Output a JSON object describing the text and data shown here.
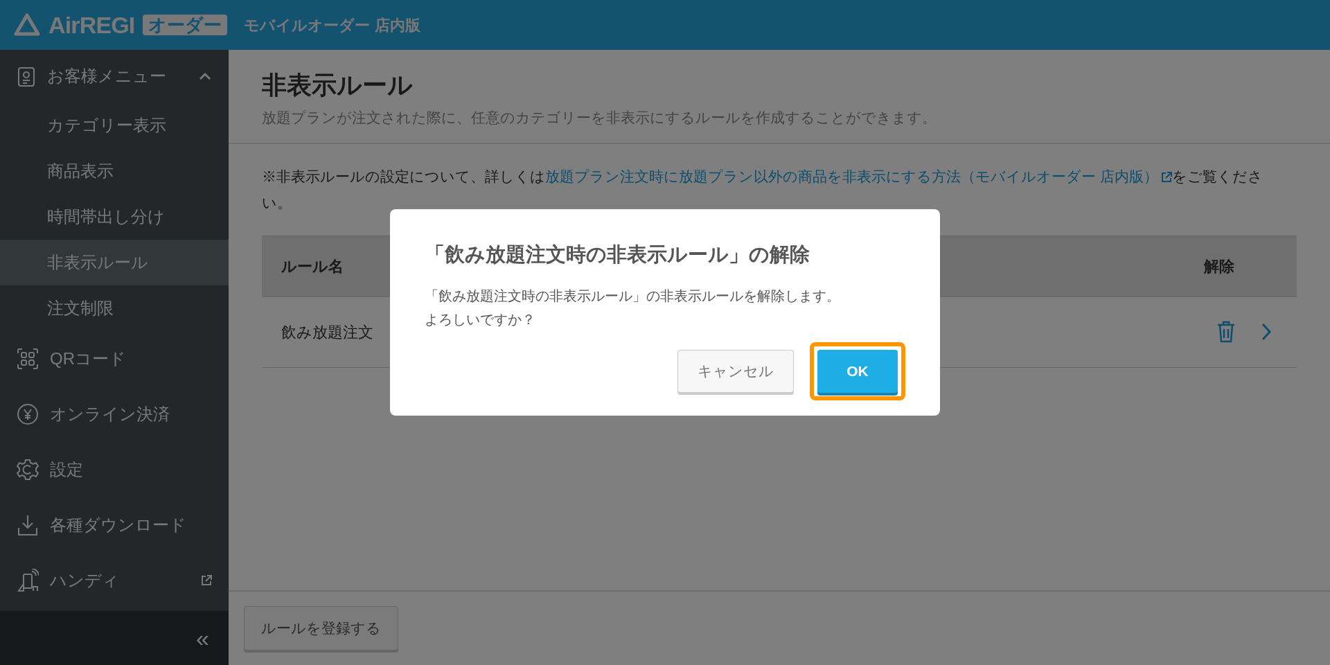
{
  "header": {
    "logo": "AirREGI",
    "badge": "オーダー",
    "product": "モバイルオーダー 店内版"
  },
  "sidebar": {
    "items": [
      {
        "kind": "group",
        "label": "お客様メニュー",
        "expanded": true,
        "children": [
          {
            "label": "カテゴリー表示",
            "selected": false
          },
          {
            "label": "商品表示",
            "selected": false
          },
          {
            "label": "時間帯出し分け",
            "selected": false
          },
          {
            "label": "非表示ルール",
            "selected": true
          },
          {
            "label": "注文制限",
            "selected": false
          }
        ]
      },
      {
        "kind": "item",
        "label": "QRコード",
        "external": false
      },
      {
        "kind": "item",
        "label": "オンライン決済",
        "external": false
      },
      {
        "kind": "item",
        "label": "設定",
        "external": false
      },
      {
        "kind": "item",
        "label": "各種ダウンロード",
        "external": false
      },
      {
        "kind": "item",
        "label": "ハンディ",
        "external": true
      }
    ],
    "collapse": "«"
  },
  "page": {
    "title": "非表示ルール",
    "subtitle": "放題プランが注文された際に、任意のカテゴリーを非表示にするルールを作成することができます。",
    "note_before": "※非表示ルールの設定について、詳しくは",
    "note_link": "放題プラン注文時に放題プラン以外の商品を非表示にする方法（モバイルオーダー 店内版）",
    "note_after": "をご覧ください。"
  },
  "table": {
    "columns": [
      "ルール名",
      "解除"
    ],
    "rows": [
      {
        "name": "飲み放題注文"
      }
    ]
  },
  "footer": {
    "button": "ルールを登録する"
  },
  "dialog": {
    "title": "「飲み放題注文時の非表示ルール」の解除",
    "message": [
      "「飲み放題注文時の非表示ルール」の非表示ルールを解除します。",
      "よろしいですか？"
    ],
    "buttons": [
      {
        "kind": "secondary",
        "label": "キャンセル",
        "highlighted": false
      },
      {
        "kind": "primary",
        "label": "OK",
        "highlighted": true
      }
    ]
  }
}
